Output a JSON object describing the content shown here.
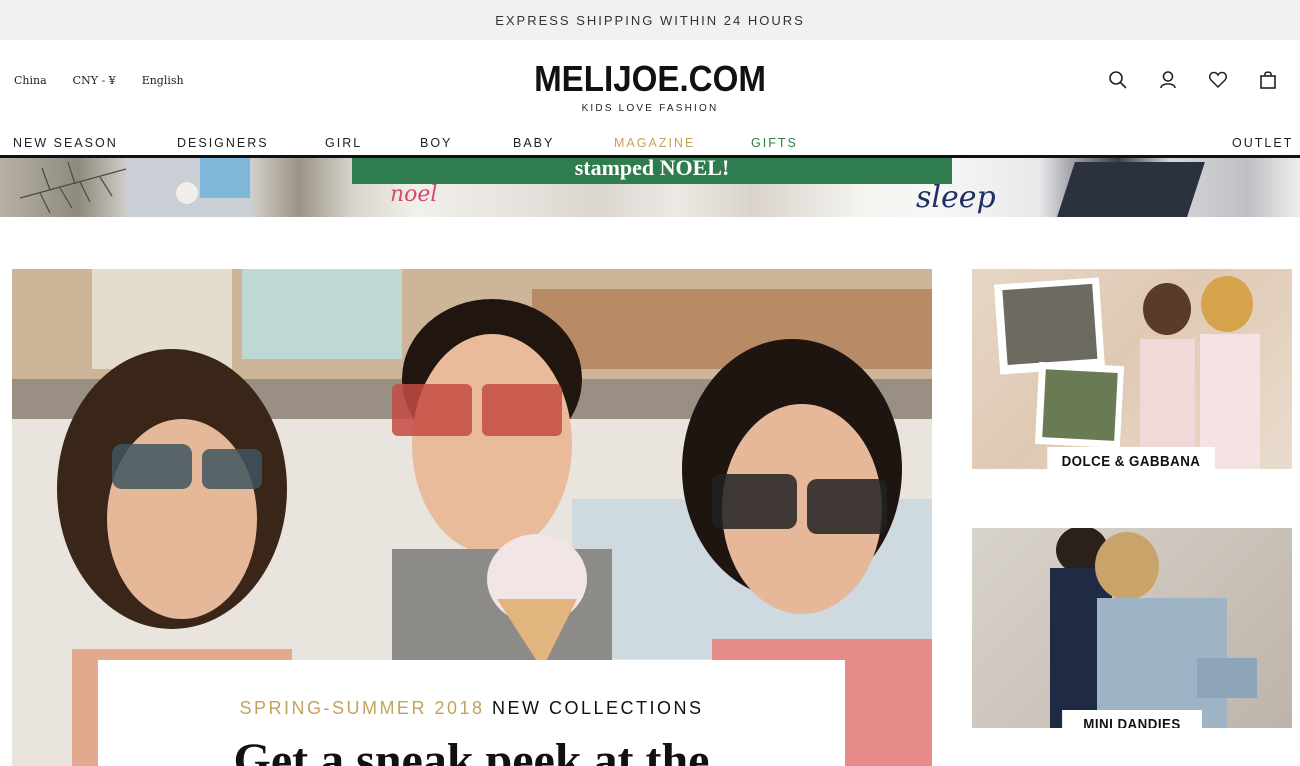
{
  "topbar": {
    "text": "EXPRESS SHIPPING WITHIN 24 HOURS"
  },
  "locale": {
    "country": "China",
    "currency": "CNY - ¥",
    "language": "English"
  },
  "brand": {
    "logo": "MELIJOE.COM",
    "tagline": "KIDS LOVE FASHION"
  },
  "header_icons": [
    "search-icon",
    "account-icon",
    "wishlist-heart-icon",
    "shopping-bag-icon"
  ],
  "nav": {
    "items": [
      {
        "label": "NEW SEASON",
        "color": "#222222"
      },
      {
        "label": "DESIGNERS",
        "color": "#222222"
      },
      {
        "label": "GIRL",
        "color": "#222222"
      },
      {
        "label": "BOY",
        "color": "#222222"
      },
      {
        "label": "BABY",
        "color": "#222222"
      },
      {
        "label": "MAGAZINE",
        "color": "#c2a35a"
      },
      {
        "label": "GIFTS",
        "color": "#2f7d4f"
      },
      {
        "label": "OUTLET",
        "color": "#222222"
      }
    ]
  },
  "banner": {
    "headline": "stamped NOEL!",
    "noel_text": "noel",
    "script_text": "sleep",
    "pill_color": "#2f7d4f"
  },
  "hero": {
    "kicker_gold": "SPRING-SUMMER 2018",
    "kicker_dark": "NEW COLLECTIONS",
    "headline": "Get a sneak peek at the"
  },
  "promos": [
    {
      "label": "DOLCE & GABBANA"
    },
    {
      "label": "MINI DANDIES"
    }
  ],
  "colors": {
    "accent_gold": "#c2a35a",
    "accent_green": "#2f7d4f",
    "topbar_bg": "#f1f1f1"
  }
}
